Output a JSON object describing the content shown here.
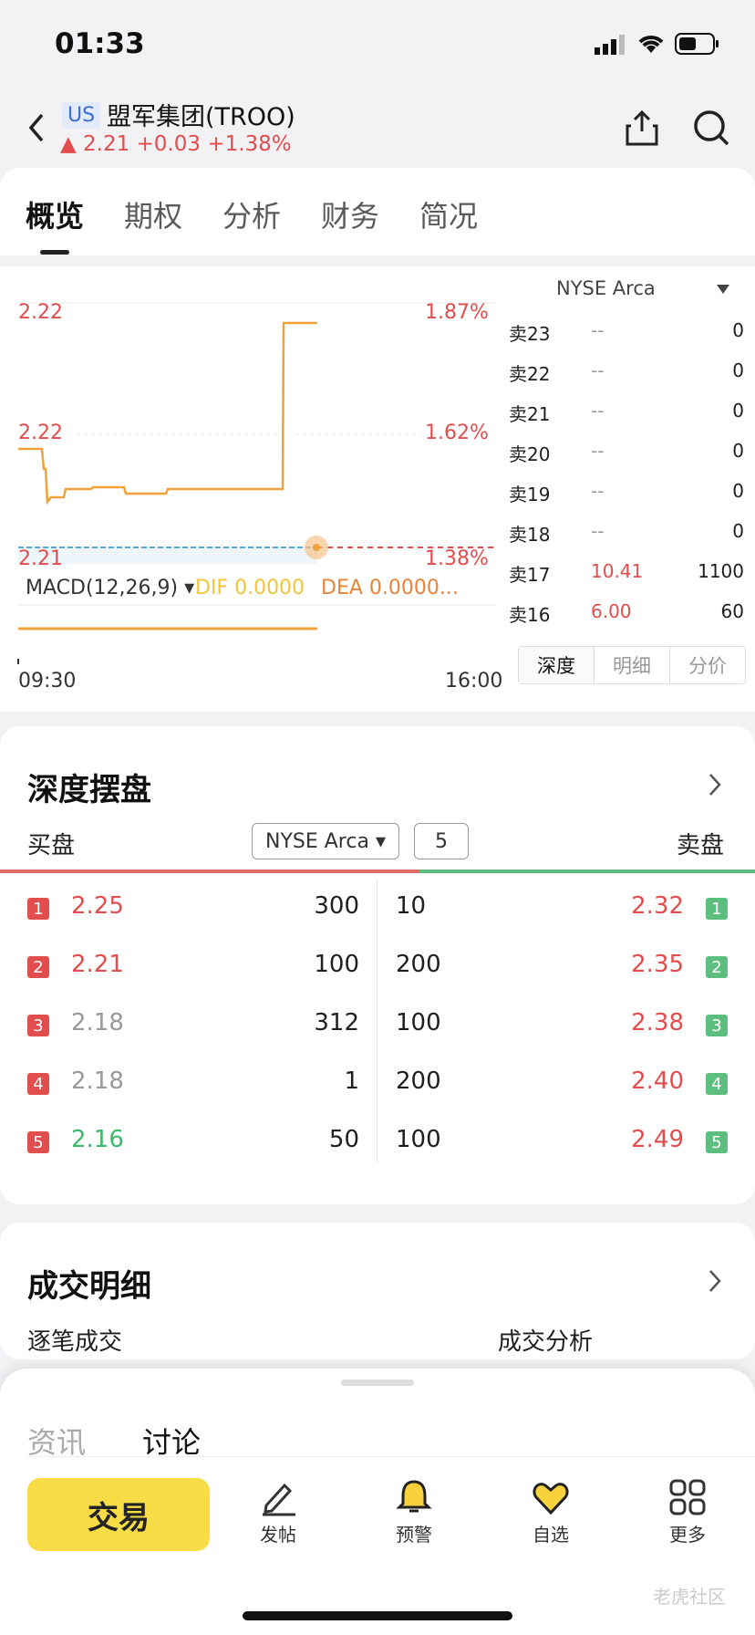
{
  "status_bar": {
    "time": "01:33"
  },
  "header": {
    "market_badge": "US",
    "stock_name": "盟军集团(TROO)",
    "price_line": "▲ 2.21 +0.03 +1.38%"
  },
  "tabs": [
    "概览",
    "期权",
    "分析",
    "财务",
    "简况"
  ],
  "chart": {
    "price_labels": [
      "2.22",
      "2.22",
      "2.21"
    ],
    "pct_labels": [
      "1.87%",
      "1.62%",
      "1.38%"
    ],
    "macd_label": "MACD(12,26,9)",
    "dif_label": "DIF 0.0000",
    "dea_label": "DEA 0.0000...",
    "x_start": "09:30",
    "x_end": "16:00",
    "colors": {
      "line": "#f0a23a",
      "up": "#e24d4d",
      "down": "#3fb86b"
    }
  },
  "orderbook": {
    "exchange": "NYSE Arca",
    "rows": [
      {
        "label": "卖23",
        "price": "--",
        "size": "0"
      },
      {
        "label": "卖22",
        "price": "--",
        "size": "0"
      },
      {
        "label": "卖21",
        "price": "--",
        "size": "0"
      },
      {
        "label": "卖20",
        "price": "--",
        "size": "0"
      },
      {
        "label": "卖19",
        "price": "--",
        "size": "0"
      },
      {
        "label": "卖18",
        "price": "--",
        "size": "0"
      },
      {
        "label": "卖17",
        "price": "10.41",
        "size": "1100"
      },
      {
        "label": "卖16",
        "price": "6.00",
        "size": "60"
      }
    ],
    "segments": [
      "深度",
      "明细",
      "分价"
    ]
  },
  "depth": {
    "title": "深度摆盘",
    "buy_label": "买盘",
    "sell_label": "卖盘",
    "exchange": "NYSE Arca",
    "levels": "5",
    "rows": [
      {
        "n": "1",
        "bid": "2.25",
        "bid_size": "300",
        "ask_size": "10",
        "ask": "2.32"
      },
      {
        "n": "2",
        "bid": "2.21",
        "bid_size": "100",
        "ask_size": "200",
        "ask": "2.35"
      },
      {
        "n": "3",
        "bid": "2.18",
        "bid_size": "312",
        "ask_size": "100",
        "ask": "2.38"
      },
      {
        "n": "4",
        "bid": "2.18",
        "bid_size": "1",
        "ask_size": "200",
        "ask": "2.40"
      },
      {
        "n": "5",
        "bid": "2.16",
        "bid_size": "50",
        "ask_size": "100",
        "ask": "2.49"
      }
    ]
  },
  "trades": {
    "title": "成交明细",
    "left": "逐笔成交",
    "right": "成交分析"
  },
  "sheet": {
    "tab1": "资讯",
    "tab2": "讨论"
  },
  "bottom": {
    "trade": "交易",
    "nav": [
      {
        "label": "发帖",
        "icon": "pencil-icon"
      },
      {
        "label": "预警",
        "icon": "bell-icon"
      },
      {
        "label": "自选",
        "icon": "heart-icon"
      },
      {
        "label": "更多",
        "icon": "grid-icon"
      }
    ]
  },
  "watermark": "老虎社区"
}
